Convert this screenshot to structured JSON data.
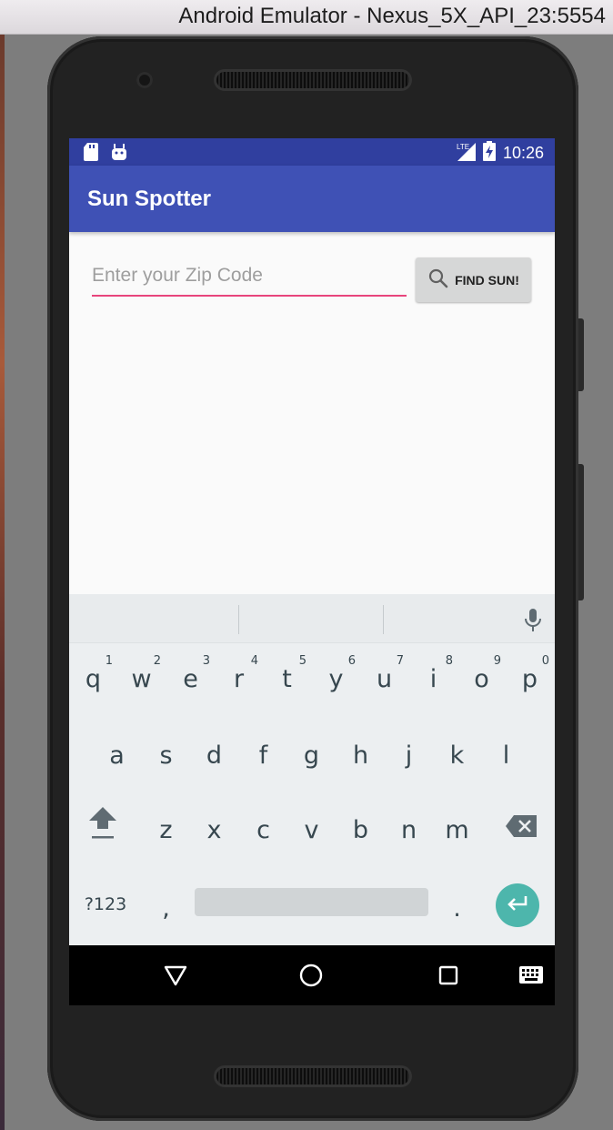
{
  "window": {
    "title": "Android Emulator - Nexus_5X_API_23:5554"
  },
  "status_bar": {
    "time": "10:26",
    "network": "LTE"
  },
  "app_bar": {
    "title": "Sun Spotter"
  },
  "zip_input": {
    "value": "",
    "placeholder": "Enter your Zip Code"
  },
  "find_button": {
    "label": "FIND SUN!",
    "icon": "search-icon"
  },
  "keyboard": {
    "row1": [
      {
        "key": "q",
        "hint": "1"
      },
      {
        "key": "w",
        "hint": "2"
      },
      {
        "key": "e",
        "hint": "3"
      },
      {
        "key": "r",
        "hint": "4"
      },
      {
        "key": "t",
        "hint": "5"
      },
      {
        "key": "y",
        "hint": "6"
      },
      {
        "key": "u",
        "hint": "7"
      },
      {
        "key": "i",
        "hint": "8"
      },
      {
        "key": "o",
        "hint": "9"
      },
      {
        "key": "p",
        "hint": "0"
      }
    ],
    "row2": [
      "a",
      "s",
      "d",
      "f",
      "g",
      "h",
      "j",
      "k",
      "l"
    ],
    "row3": [
      "z",
      "x",
      "c",
      "v",
      "b",
      "n",
      "m"
    ],
    "symbols_label": "?123",
    "comma": ",",
    "period": "."
  },
  "colors": {
    "primary": "#3f51b5",
    "primary_dark": "#303f9f",
    "accent": "#e8457c",
    "enter": "#4db6ac"
  }
}
